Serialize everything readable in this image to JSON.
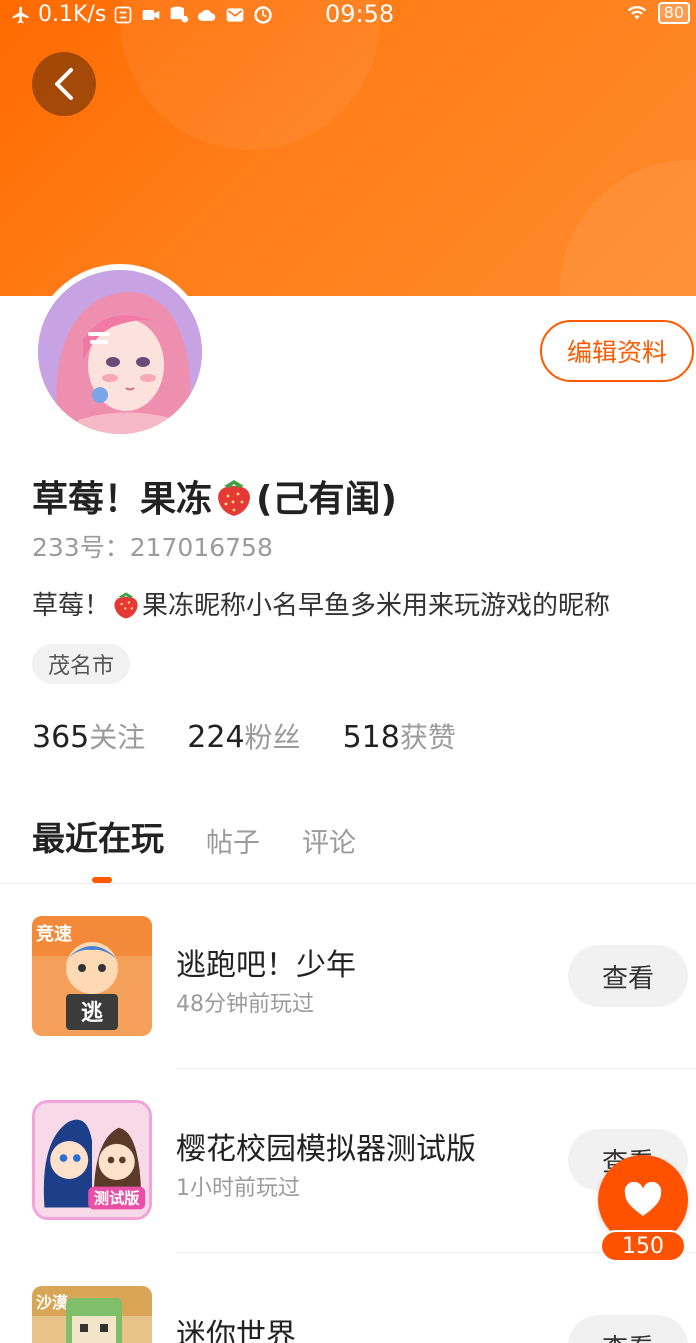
{
  "status_bar": {
    "net_speed": "0.1K/s",
    "time": "09:58",
    "battery": "80"
  },
  "profile": {
    "edit_label": "编辑资料",
    "name_part1": "草莓！果冻",
    "name_part2": "(己有闺)",
    "uid": "233号：217016758",
    "bio_part1": "草莓！",
    "bio_part2": "果冻昵称小名早鱼多米用来玩游戏的昵称",
    "location": "茂名市",
    "stats": [
      {
        "num": "365",
        "label": "关注"
      },
      {
        "num": "224",
        "label": "粉丝"
      },
      {
        "num": "518",
        "label": "获赞"
      }
    ]
  },
  "tabs": [
    {
      "label": "最近在玩",
      "active": true
    },
    {
      "label": "帖子",
      "active": false
    },
    {
      "label": "评论",
      "active": false
    }
  ],
  "games": [
    {
      "title": "逃跑吧！少年",
      "played": "48分钟前玩过",
      "button": "查看",
      "icon_badge": "竞速",
      "icon_char": "逃"
    },
    {
      "title": "樱花校园模拟器测试版",
      "played": "1小时前玩过",
      "button": "查看",
      "icon_badge": "测试版"
    },
    {
      "title": "迷你世界",
      "played": "",
      "button": "查看",
      "icon_badge": "沙漠"
    }
  ],
  "favorite": {
    "count": "150"
  },
  "colors": {
    "accent": "#ff5a00",
    "banner": "#ff7a1a"
  }
}
